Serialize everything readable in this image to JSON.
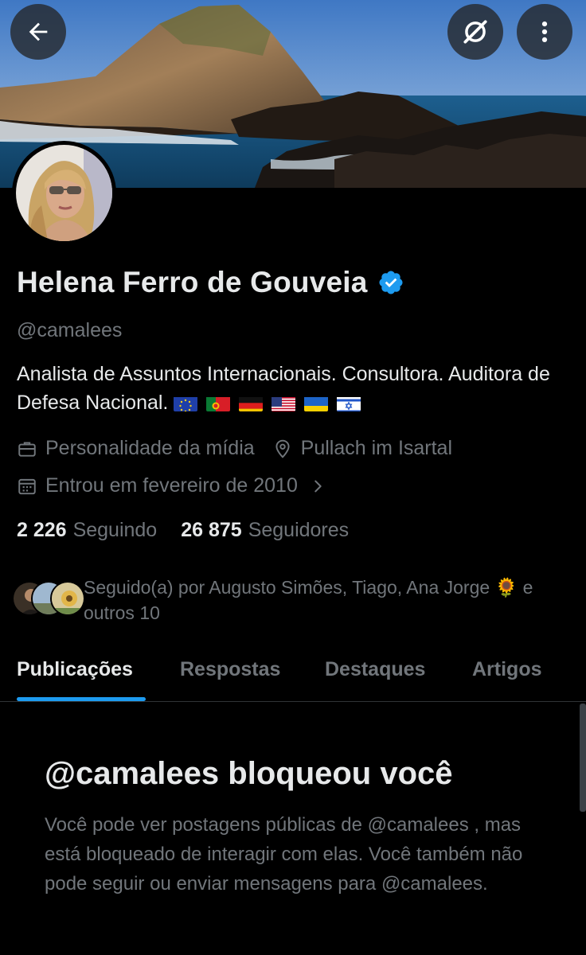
{
  "header": {
    "back_icon": "arrow-left-icon",
    "grok_icon": "grok-icon",
    "more_icon": "more-vertical-icon"
  },
  "profile": {
    "name": "Helena Ferro de Gouveia",
    "verified": true,
    "verified_color": "#1d9bf0",
    "handle": "@camalees",
    "bio_text": "Analista de Assuntos Internacionais. Consultora. Auditora de Defesa Nacional.",
    "bio_flags": [
      "eu-flag",
      "portugal-flag",
      "germany-flag",
      "usa-flag",
      "ukraine-flag",
      "israel-flag"
    ],
    "category": "Personalidade da mídia",
    "location": "Pullach im Isartal",
    "joined": "Entrou em fevereiro de 2010"
  },
  "stats": {
    "following_count": "2 226",
    "following_label": "Seguindo",
    "followers_count": "26 875",
    "followers_label": "Seguidores"
  },
  "followed_by": {
    "text": "Seguido(a) por Augusto Simões, Tiago, Ana Jorge 🌻 e outros 10"
  },
  "tabs": [
    {
      "label": "Publicações",
      "active": true
    },
    {
      "label": "Respostas",
      "active": false
    },
    {
      "label": "Destaques",
      "active": false
    },
    {
      "label": "Artigos",
      "active": false
    }
  ],
  "blocked": {
    "title": "@camalees bloqueou você",
    "description": "Você pode ver postagens públicas de @camalees , mas está bloqueado de interagir com elas. Você também não pode seguir ou enviar mensagens para @camalees."
  },
  "colors": {
    "background": "#000000",
    "primary_text": "#e7e9ea",
    "secondary_text": "#71767b",
    "accent": "#1d9bf0"
  }
}
